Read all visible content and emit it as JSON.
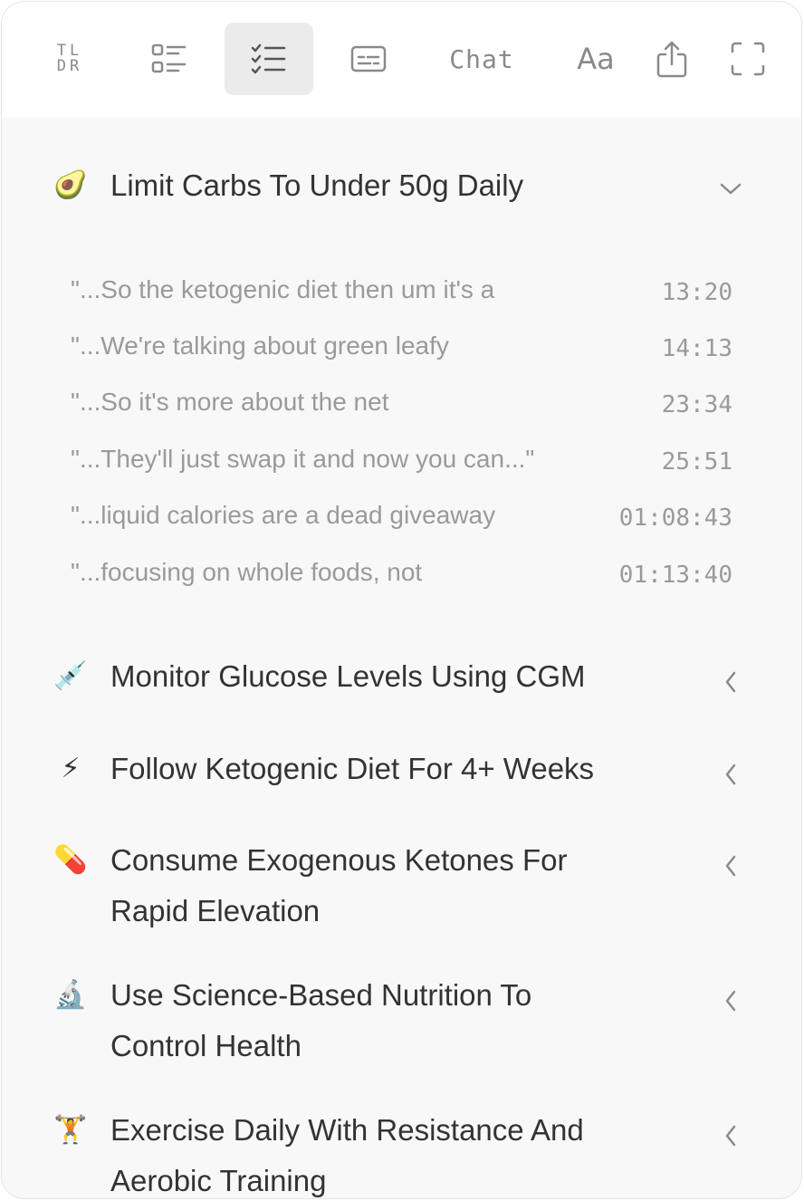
{
  "toolbar": {
    "tldr_label_top": "TL",
    "tldr_label_bottom": "DR",
    "chat_label": "Chat",
    "font_label": "Aa"
  },
  "sections": [
    {
      "emoji": "🥑",
      "title": "Limit Carbs To Under 50g Daily",
      "expanded": true,
      "quotes": [
        {
          "text": "\"...So the ketogenic diet then um it's a",
          "time": "13:20"
        },
        {
          "text": "\"...We're talking about green leafy",
          "time": "14:13"
        },
        {
          "text": "\"...So it's more about the net",
          "time": "23:34"
        },
        {
          "text": "\"...They'll just swap it and now you can...\"",
          "time": "25:51"
        },
        {
          "text": "\"...liquid calories are a dead giveaway",
          "time": "01:08:43"
        },
        {
          "text": "\"...focusing on whole foods, not",
          "time": "01:13:40"
        }
      ]
    },
    {
      "emoji": "💉",
      "title_lines": [
        "Monitor Glucose Levels Using CGM"
      ],
      "expanded": false
    },
    {
      "emoji": "⚡",
      "title_lines": [
        "Follow Ketogenic Diet For 4+ Weeks"
      ],
      "expanded": false
    },
    {
      "emoji": "💊",
      "title_lines": [
        "Consume Exogenous Ketones For",
        "Rapid Elevation"
      ],
      "expanded": false
    },
    {
      "emoji": "🔬",
      "title_lines": [
        "Use Science-Based Nutrition To",
        "Control Health"
      ],
      "expanded": false
    },
    {
      "emoji": "🏋",
      "title_lines": [
        "Exercise Daily With Resistance And",
        "Aerobic Training"
      ],
      "expanded": false
    }
  ]
}
